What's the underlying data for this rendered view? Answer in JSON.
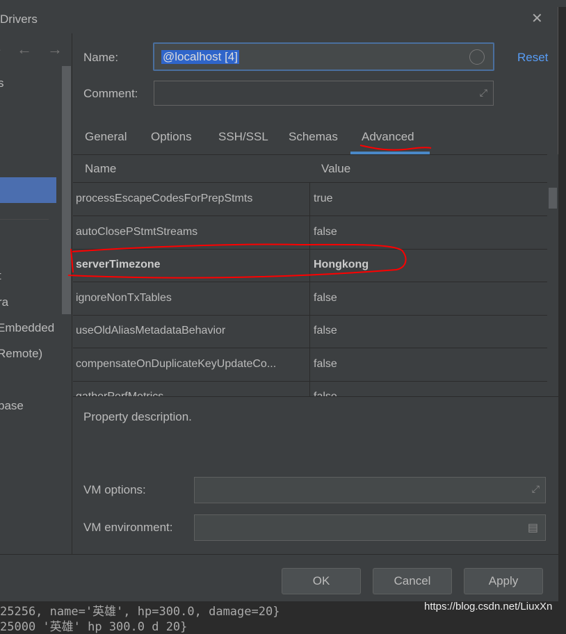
{
  "dialog": {
    "title": "Drivers",
    "close_icon": "close-icon"
  },
  "left_panel": {
    "items": [
      "s",
      "t",
      "ra",
      "Embedded",
      "Remote)",
      "base"
    ]
  },
  "form": {
    "name_label": "Name:",
    "name_value": "@localhost [4]",
    "reset_label": "Reset",
    "comment_label": "Comment:",
    "comment_value": ""
  },
  "tabs": [
    {
      "label": "General"
    },
    {
      "label": "Options"
    },
    {
      "label": "SSH/SSL"
    },
    {
      "label": "Schemas"
    },
    {
      "label": "Advanced",
      "active": true
    }
  ],
  "table": {
    "headers": [
      "Name",
      "Value"
    ],
    "rows": [
      {
        "name": "processEscapeCodesForPrepStmts",
        "value": "true"
      },
      {
        "name": "autoClosePStmtStreams",
        "value": "false"
      },
      {
        "name": "serverTimezone",
        "value": "Hongkong",
        "bold": true
      },
      {
        "name": "ignoreNonTxTables",
        "value": "false"
      },
      {
        "name": "useOldAliasMetadataBehavior",
        "value": "false"
      },
      {
        "name": "compensateOnDuplicateKeyUpdateCo...",
        "value": "false"
      },
      {
        "name": "gatherPerfMetrics",
        "value": "false"
      }
    ]
  },
  "description": "Property description.",
  "vm": {
    "options_label": "VM options:",
    "options_value": "",
    "env_label": "VM environment:",
    "env_value": ""
  },
  "buttons": {
    "ok": "OK",
    "cancel": "Cancel",
    "apply": "Apply"
  },
  "background": {
    "console_line": "25256, name='英雄', hp=300.0, damage=20}",
    "console_line2": "25000  '英雄' hp 300.0 d     20}",
    "watermark": "https://blog.csdn.net/LiuxXn"
  },
  "colors": {
    "accent": "#4a88c7",
    "selection": "#4b6eaf",
    "link": "#589df6",
    "annotation": "#ff0000"
  }
}
